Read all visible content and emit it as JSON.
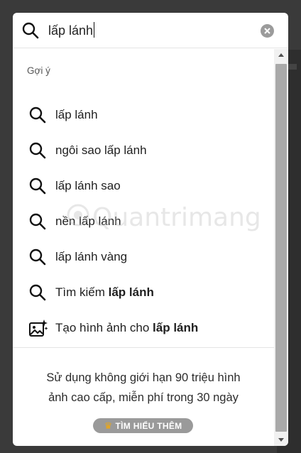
{
  "search": {
    "query": "lấp lánh",
    "clear_icon": "close-circle-icon"
  },
  "suggestions": {
    "heading": "Gợi ý",
    "items": [
      {
        "label": "lấp lánh",
        "icon": "search-icon"
      },
      {
        "label": "ngôi sao lấp lánh",
        "icon": "search-icon"
      },
      {
        "label": "lấp lánh sao",
        "icon": "search-icon"
      },
      {
        "label": "nền lấp lánh",
        "icon": "search-icon"
      },
      {
        "label": "lấp lánh vàng",
        "icon": "search-icon"
      }
    ],
    "search_for": {
      "prefix": "Tìm kiếm ",
      "term": "lấp lánh",
      "icon": "search-icon"
    },
    "generate": {
      "prefix": "Tạo hình ảnh cho ",
      "term": "lấp lánh",
      "icon": "image-sparkle-icon"
    }
  },
  "promo": {
    "line1": "Sử dụng không giới hạn 90 triệu hình",
    "line2": "ảnh cao cấp, miễn phí trong 30 ngày",
    "button_label": "TÌM HIỂU THÊM",
    "button_icon": "crown-icon"
  },
  "watermark": {
    "text": "Quantrimang"
  },
  "colors": {
    "panel_bg": "#ffffff",
    "backdrop": "#3a3a3a",
    "learn_button_bg": "#9a9a9a",
    "crown": "#f0a810",
    "scroll_thumb": "#a9a9a9"
  }
}
